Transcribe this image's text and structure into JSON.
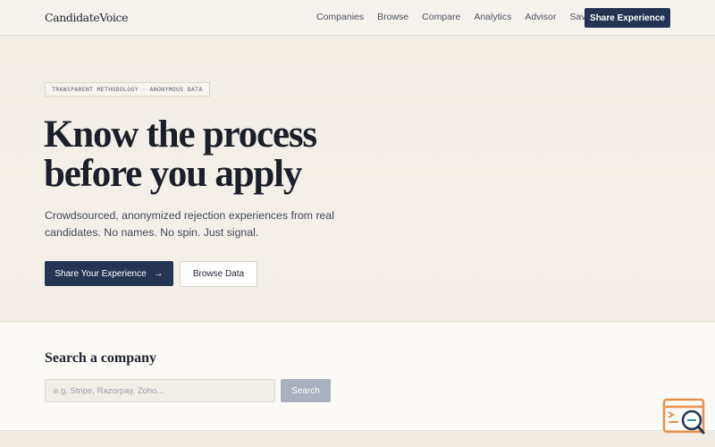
{
  "nav": {
    "logo": "CandidateVoice",
    "links": [
      "Companies",
      "Browse",
      "Compare",
      "Analytics",
      "Advisor",
      "Saved"
    ],
    "cta": "Share Experience"
  },
  "hero": {
    "badge": "TRANSPARENT METHODOLOGY · ANONYMOUS DATA",
    "title_line1": "Know the process",
    "title_line2": "before you apply",
    "subtitle": "Crowdsourced, anonymized rejection experiences from real candidates. No names. No spin. Just signal.",
    "primary_button": "Share Your Experience",
    "primary_icon": "→",
    "secondary_button": "Browse Data"
  },
  "search": {
    "title": "Search a company",
    "placeholder": "e.g. Stripe, Razorpay, Zoho...",
    "button": "Search"
  },
  "colors": {
    "primary": "#243553",
    "background": "#f3efe7",
    "search_button": "#a9b0be",
    "widget_accent": "#e9914a"
  },
  "icons": {
    "widget": "search-code-icon",
    "arrow": "arrow-right-icon"
  }
}
